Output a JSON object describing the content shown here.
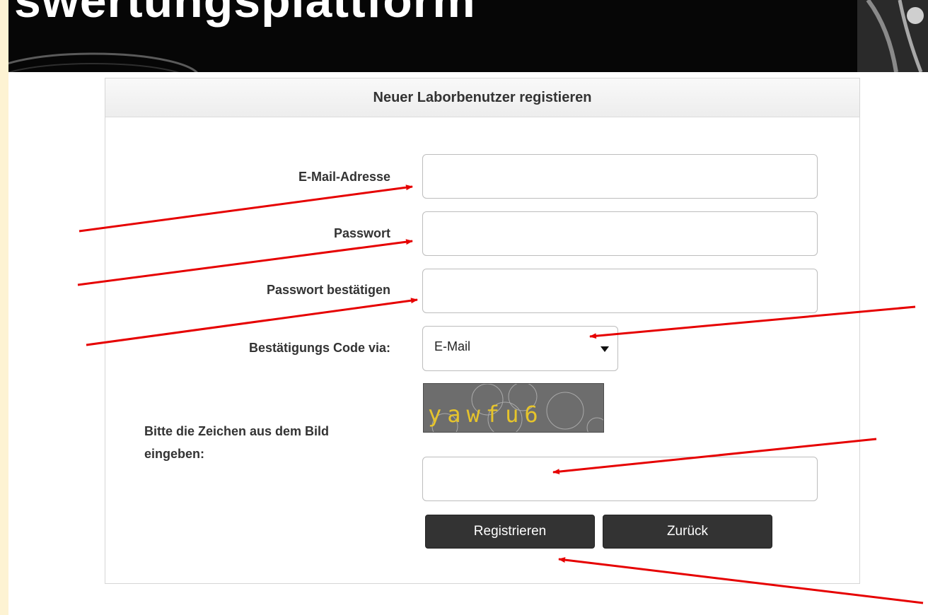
{
  "banner": {
    "title": "swertungsplattform"
  },
  "form": {
    "title": "Neuer Laborbenutzer registieren",
    "email_label": "E-Mail-Adresse",
    "email_value": "",
    "password_label": "Passwort",
    "password_value": "",
    "confirm_label": "Passwort bestätigen",
    "confirm_value": "",
    "code_via_label": "Bestätigungs Code via:",
    "code_via_selected": "E-Mail",
    "captcha_text": "yawfu6",
    "captcha_label_line1": "Bitte die Zeichen aus dem Bild",
    "captcha_label_line2": "eingeben:",
    "captcha_value": "",
    "register_label": "Registrieren",
    "back_label": "Zurück"
  },
  "colors": {
    "page_background": "#fdf3d3",
    "annotation_arrow": "#e60000",
    "button_background": "#333333",
    "captcha_text": "#e6c42b"
  },
  "icons": {
    "select_caret": "caret-down-icon",
    "annotation": "red-arrow-icon"
  }
}
